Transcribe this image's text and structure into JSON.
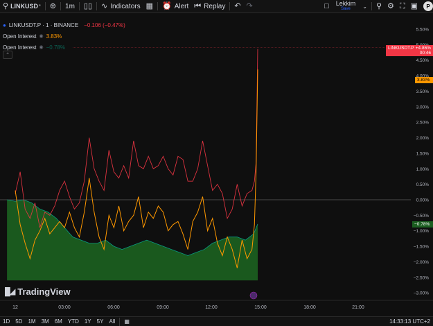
{
  "topbar": {
    "symbol": "LINKUSD",
    "symbol_suffix": "*",
    "interval": "1m",
    "indicators_label": "Indicators",
    "alert_label": "Alert",
    "replay_label": "Replay",
    "account_name": "Lekkim",
    "account_sub": "Save",
    "avatar_letter": "P"
  },
  "legend": {
    "title": "LINKUSDT.P · 1 · BINANCE",
    "change": "−0.106 (−0.47%)",
    "oi1_label": "Open Interest",
    "oi1_value": "3.83%",
    "oi2_label": "Open Interest",
    "oi2_value": "−0.78%"
  },
  "price_labels": {
    "main_symbol": "LINKUSDT.P",
    "main_value": "+4.86%",
    "main_countdown": "00:46",
    "oi1_value": "3.83%",
    "oi2_value": "−0.78%"
  },
  "colors": {
    "main_line": "#f23645",
    "oi1": "#ff9800",
    "oi2_fill": "#1b5e20",
    "oi2_line": "#089981",
    "background": "#0f0f0f"
  },
  "watermark": "TradingView",
  "chart_data": {
    "type": "line",
    "y_ticks": [
      "5.50%",
      "5.00%",
      "4.50%",
      "4.00%",
      "3.50%",
      "3.00%",
      "2.50%",
      "2.00%",
      "1.50%",
      "1.00%",
      "0.50%",
      "0.00%",
      "−0.50%",
      "−1.00%",
      "−1.50%",
      "−2.00%",
      "−2.50%",
      "−3.00%"
    ],
    "x_ticks": [
      "12",
      "03:00",
      "06:00",
      "09:00",
      "12:00",
      "15:00",
      "18:00",
      "21:00"
    ],
    "ylim": [
      -3.2,
      5.6
    ],
    "xlim_hours": [
      -0.5,
      23.8
    ],
    "series": [
      {
        "name": "LINKUSDT.P",
        "x": [
          0,
          0.3,
          0.6,
          0.9,
          1.2,
          1.5,
          1.8,
          2.1,
          2.4,
          2.7,
          3.0,
          3.3,
          3.6,
          3.9,
          4.2,
          4.5,
          4.8,
          5.1,
          5.4,
          5.7,
          6.0,
          6.3,
          6.6,
          6.9,
          7.2,
          7.5,
          7.8,
          8.1,
          8.4,
          8.7,
          9.0,
          9.3,
          9.6,
          9.9,
          10.2,
          10.5,
          10.8,
          11.1,
          11.4,
          11.7,
          12.0,
          12.3,
          12.6,
          12.9,
          13.2,
          13.5,
          13.8,
          14.1,
          14.4,
          14.55,
          14.65,
          14.75
        ],
        "y": [
          0.2,
          0.9,
          -0.3,
          -0.6,
          -0.1,
          -0.9,
          -0.4,
          -0.5,
          -0.2,
          0.3,
          0.6,
          0.1,
          -0.3,
          -0.1,
          0.6,
          2.0,
          1.0,
          0.6,
          0.3,
          1.6,
          0.9,
          0.7,
          1.1,
          0.7,
          1.9,
          1.1,
          1.0,
          1.4,
          1.0,
          1.1,
          1.4,
          1.0,
          0.8,
          1.4,
          1.3,
          0.6,
          0.6,
          1.0,
          1.9,
          1.1,
          0.3,
          0.5,
          0.2,
          -0.6,
          -0.3,
          0.5,
          -0.2,
          0.2,
          0.3,
          0.6,
          1.2,
          4.86
        ]
      },
      {
        "name": "Open Interest",
        "x": [
          0,
          0.3,
          0.6,
          0.9,
          1.2,
          1.5,
          1.8,
          2.1,
          2.4,
          2.7,
          3.0,
          3.3,
          3.6,
          3.9,
          4.2,
          4.5,
          4.8,
          5.1,
          5.4,
          5.7,
          6.0,
          6.3,
          6.6,
          6.9,
          7.2,
          7.5,
          7.8,
          8.1,
          8.4,
          8.7,
          9.0,
          9.3,
          9.6,
          9.9,
          10.2,
          10.5,
          10.8,
          11.1,
          11.4,
          11.7,
          12.0,
          12.3,
          12.6,
          12.9,
          13.2,
          13.5,
          13.8,
          14.1,
          14.4,
          14.55,
          14.65,
          14.75
        ],
        "y": [
          0.3,
          -0.8,
          -1.4,
          -1.9,
          -1.3,
          -1.0,
          -0.6,
          -1.1,
          -0.9,
          -0.7,
          -0.9,
          -0.4,
          -0.9,
          -1.2,
          -0.4,
          0.7,
          -0.4,
          -1.2,
          -1.6,
          -0.5,
          -0.9,
          -0.2,
          -1.0,
          -0.7,
          -0.5,
          0.1,
          -0.9,
          -0.4,
          -0.6,
          -0.2,
          -0.4,
          -1.0,
          -0.8,
          -0.7,
          -1.1,
          -1.6,
          -0.7,
          -0.4,
          0.1,
          -1.0,
          -0.6,
          -1.4,
          -1.8,
          -1.2,
          -1.6,
          -2.2,
          -1.3,
          -1.9,
          -1.6,
          -0.8,
          0.9,
          4.2
        ]
      },
      {
        "name": "Open Interest",
        "x": [
          -0.5,
          0,
          0.5,
          1.0,
          1.5,
          2.0,
          2.5,
          3.0,
          3.5,
          4.0,
          4.5,
          5.0,
          5.5,
          6.0,
          6.5,
          7.0,
          7.5,
          8.0,
          8.5,
          9.0,
          9.5,
          10.0,
          10.5,
          11.0,
          11.5,
          12.0,
          12.5,
          13.0,
          13.5,
          14.0,
          14.5,
          14.75
        ],
        "y": [
          0.0,
          -0.05,
          0.0,
          -0.1,
          -0.3,
          -0.4,
          -0.6,
          -0.9,
          -1.2,
          -1.3,
          -1.4,
          -1.4,
          -1.3,
          -1.5,
          -1.6,
          -1.5,
          -1.4,
          -1.3,
          -1.4,
          -1.5,
          -1.6,
          -1.7,
          -1.8,
          -1.7,
          -1.6,
          -1.4,
          -1.3,
          -1.2,
          -1.2,
          -1.3,
          -1.1,
          -0.78
        ]
      }
    ]
  }
}
